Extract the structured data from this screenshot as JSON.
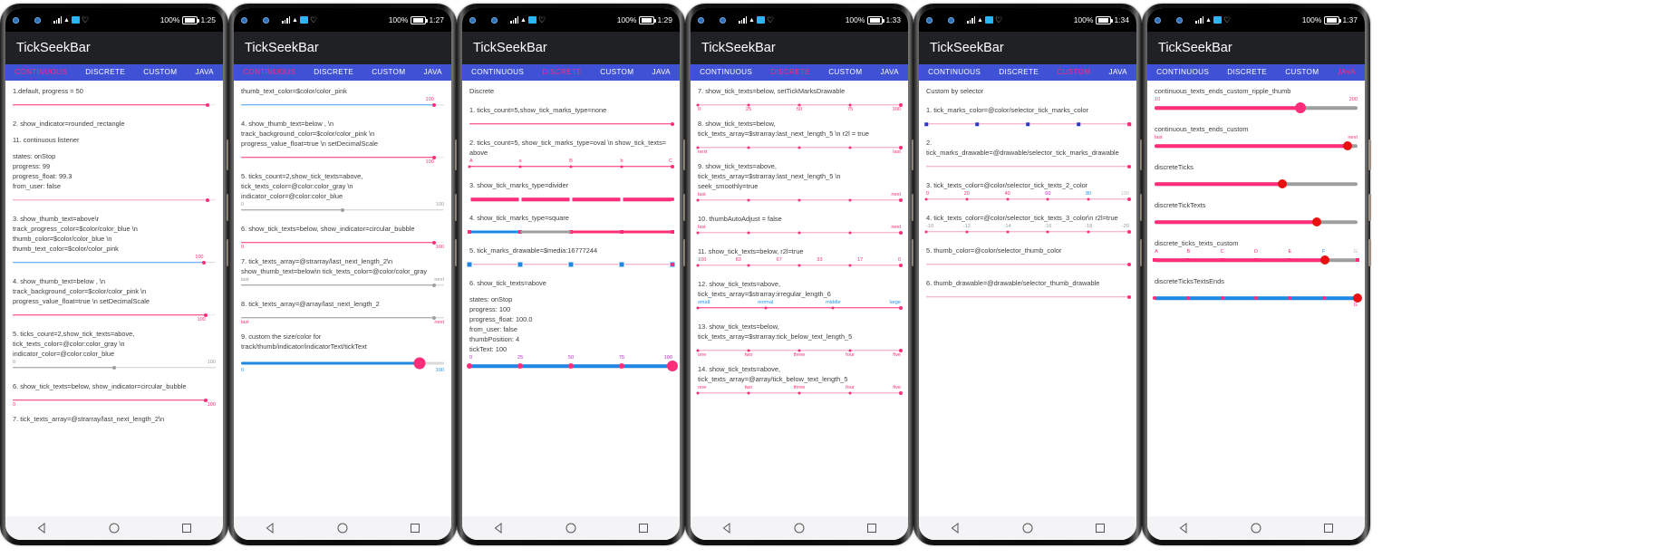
{
  "app": {
    "title": "TickSeekBar"
  },
  "tabs": [
    "CONTINUOUS",
    "DISCRETE",
    "CUSTOM",
    "JAVA"
  ],
  "status": {
    "battery_pct": "100%",
    "times": [
      "1:25",
      "1:27",
      "1:29",
      "1:33",
      "1:34",
      "1:37"
    ]
  },
  "phones": [
    {
      "active_tab": "CONTINUOUS",
      "time": "1:25",
      "blocks": [
        {
          "label": "1.default, progress = 50",
          "thumb_pct": 96,
          "prog_pct": 96,
          "track": "pink"
        },
        {
          "label": "2. show_indicator=rounded_rectangle"
        },
        {
          "label": "11. continuous listener"
        },
        {
          "label": "states: onStop\nprogress: 99\nprogress_float: 99.3\nfrom_user: false",
          "thumb_pct": 96,
          "prog_pct": 96,
          "track": "lightpink"
        },
        {
          "label": "3. show_thumb_text=above\\r track_progress_color=$color/color_blue          \\n thumb_color=$color/color_blue \\n thumb_text_color=$color/color_pink",
          "thumb_pct": 94,
          "prog_pct": 94,
          "track": "blue",
          "thumb_text": "100",
          "thumb_text_pos": "above"
        },
        {
          "label": "4. show_thumb_text=below , \\n track_background_color=$color/color_pink \\n progress_value_float=true \\n setDecimalScale",
          "thumb_pct": 95,
          "prog_pct": 95,
          "track": "pink",
          "thumb_text": "100",
          "thumb_text_pos": "below"
        },
        {
          "label": "5. ticks_count=2,show_tick_texts=above, tick_texts_color=@color:color_gray               \\n indicator_color=@color:color_blue",
          "thumb_pct": 50,
          "prog_pct": 50,
          "track": "gray",
          "tick_texts": [
            "0",
            "100"
          ],
          "tick_text_pos": "above",
          "tick_text_color": "gray"
        },
        {
          "label": "6. show_tick_texts=below, show_indicator=circular_bubble",
          "thumb_pct": 95,
          "prog_pct": 95,
          "track": "pink",
          "tick_texts": [
            "0",
            "100"
          ],
          "tick_text_pos": "below"
        },
        {
          "label": "7. tick_texts_array=@strarray/last_next_length_2\\n"
        }
      ]
    },
    {
      "active_tab": "CONTINUOUS",
      "time": "1:27",
      "blocks": [
        {
          "label": "thumb_text_color=$color/color_pink",
          "thumb_pct": 95,
          "prog_pct": 95,
          "track": "blue",
          "thumb_text": "100",
          "thumb_text_pos": "above"
        },
        {
          "label": "4. show_thumb_text=below , \\n track_background_color=$color/color_pink \\n progress_value_float=true \\n setDecimalScale",
          "thumb_pct": 95,
          "prog_pct": 95,
          "track": "pink",
          "thumb_text": "100",
          "thumb_text_pos": "below"
        },
        {
          "label": "5. ticks_count=2,show_tick_texts=above, tick_texts_color=@color:color_gray          \\n indicator_color=@color:color_blue",
          "thumb_pct": 50,
          "prog_pct": 50,
          "track": "gray",
          "tick_texts": [
            "0",
            "100"
          ],
          "tick_text_pos": "above",
          "tick_text_color": "gray"
        },
        {
          "label": "6. show_tick_texts=below, show_indicator=circular_bubble",
          "thumb_pct": 95,
          "prog_pct": 95,
          "track": "pink",
          "tick_texts": [
            "0",
            "100"
          ],
          "tick_text_pos": "below"
        },
        {
          "label": "7. tick_texts_array=@strarray/last_next_length_2\\n show_thumb_text=below\\n tick_texts_color=@color/color_gray",
          "thumb_pct": 95,
          "prog_pct": 95,
          "track": "gray",
          "tick_texts": [
            "last",
            "next"
          ],
          "tick_text_pos": "above",
          "tick_text_color": "gray"
        },
        {
          "label": "8. tick_texts_array=@array/last_next_length_2",
          "thumb_pct": 95,
          "prog_pct": 95,
          "track": "gray",
          "tick_texts": [
            "last",
            "next"
          ],
          "tick_text_pos": "below"
        },
        {
          "label": "9. custom the size/color for track/thumb/indicator/indicatorText/tickText",
          "thumb_pct": 88,
          "prog_pct": 88,
          "track": "blue-thick",
          "thumb_style": "green",
          "tick_texts": [
            "0",
            "100"
          ],
          "tick_text_pos": "below",
          "tick_text_color": "blue"
        }
      ]
    },
    {
      "active_tab": "DISCRETE",
      "time": "1:29",
      "heading": "Discrete",
      "blocks": [
        {
          "label": "1. ticks_count=5,show_tick_marks_type=none",
          "thumb_pct": 100,
          "prog_pct": 100,
          "track": "pink"
        },
        {
          "label": "2. ticks_count=5, show_tick_marks_type=oval \\n show_tick_texts= above",
          "thumb_pct": 100,
          "prog_pct": 100,
          "track": "pink",
          "ticks": 5,
          "tick_texts": [
            "A",
            "a",
            "B",
            "b",
            "C"
          ],
          "tick_text_pos": "above",
          "tick_text_color": "pink"
        },
        {
          "label": "3. show_tick_marks_type=divider",
          "thumb_pct": 100,
          "prog_pct": 100,
          "track": "pink-thicker",
          "ticks": 5,
          "tick_style": "divider"
        },
        {
          "label": "4. show_tick_marks_type=square",
          "thumb_pct": 100,
          "prog_pct": 100,
          "track": "mixed",
          "ticks": 5,
          "tick_style": "square"
        },
        {
          "label": "5. tick_marks_drawable=$media:16777244",
          "thumb_pct": 100,
          "prog_pct": 100,
          "track": "lightpink",
          "ticks": 5,
          "tick_style": "drawable"
        },
        {
          "label": "6. show_tick_texts=above"
        },
        {
          "label": "states: onStop\nprogress: 100\nprogress_float: 100.0\nfrom_user: false\nthumbPosition: 4\ntickText: 100",
          "thumb_pct": 100,
          "prog_pct": 100,
          "track": "blue-thicker",
          "ticks": 5,
          "tick_style": "bigdot",
          "tick_texts": [
            "0",
            "25",
            "50",
            "75",
            "100"
          ],
          "tick_text_pos": "above",
          "tick_text_color": "purple",
          "thumb_style": "big"
        }
      ]
    },
    {
      "active_tab": "DISCRETE",
      "time": "1:33",
      "blocks": [
        {
          "label": "7. show_tick_texts=below, setTickMarksDrawable",
          "thumb_pct": 100,
          "prog_pct": 100,
          "track": "lightpink",
          "ticks": 5,
          "tick_texts": [
            "0",
            "25",
            "50",
            "75",
            "100"
          ],
          "tick_text_pos": "below"
        },
        {
          "label": "8. show_tick_texts=below, tick_texts_array=$strarray:last_next_length_5 \\n r2l = true",
          "thumb_pct": 100,
          "prog_pct": 100,
          "track": "lightpink",
          "ticks": 5,
          "tick_texts": [
            "next",
            "",
            "",
            "",
            "last"
          ],
          "tick_text_pos": "below"
        },
        {
          "label": "9. show_tick_texts=above, tick_texts_array=$strarray:last_next_length_5 \\n seek_smoothly=true",
          "thumb_pct": 100,
          "prog_pct": 100,
          "track": "lightpink",
          "ticks": 5,
          "tick_texts": [
            "last",
            "",
            "",
            "",
            "next"
          ],
          "tick_text_pos": "above"
        },
        {
          "label": "10. thumbAutoAdjust = false",
          "thumb_pct": 100,
          "prog_pct": 100,
          "track": "lightpink",
          "ticks": 5,
          "tick_texts": [
            "last",
            "",
            "",
            "",
            "next"
          ],
          "tick_text_pos": "above"
        },
        {
          "label": "11. show_tick_texts=below, r2l=true",
          "thumb_pct": 100,
          "prog_pct": 100,
          "track": "lightpink",
          "ticks": 5,
          "tick_texts": [
            "100",
            "83",
            "67",
            "33",
            "17",
            "0"
          ],
          "tick_text_pos": "above"
        },
        {
          "label": "12. show_tick_texts=above, tick_texts_array=$strarray:irregular_length_6",
          "thumb_pct": 100,
          "prog_pct": 100,
          "track": "pink",
          "ticks": 4,
          "tick_texts": [
            "small",
            "normal",
            "middle",
            "large"
          ],
          "tick_text_pos": "above",
          "tick_text_color": "blue"
        },
        {
          "label": "13. show_tick_texts=below, tick_texts_array=$strarray:tick_below_text_length_5",
          "thumb_pct": 100,
          "prog_pct": 100,
          "track": "lightpink",
          "ticks": 5,
          "tick_texts": [
            "one",
            "two",
            "three",
            "four",
            "five"
          ],
          "tick_text_pos": "below"
        },
        {
          "label": "14. show_tick_texts=above, tick_texts_array=@array/tick_below_text_length_5",
          "thumb_pct": 100,
          "prog_pct": 100,
          "track": "lightpink",
          "ticks": 5,
          "tick_texts": [
            "one",
            "two",
            "three",
            "four",
            "five"
          ],
          "tick_text_pos": "above"
        }
      ]
    },
    {
      "active_tab": "CUSTOM",
      "time": "1:34",
      "heading": "Custom by selector",
      "blocks": [
        {
          "label": "1. tick_marks_color=@color/selector_tick_marks_color",
          "thumb_pct": 100,
          "prog_pct": 100,
          "track": "lightpink",
          "ticks": 5,
          "tick_style": "bluesq"
        },
        {
          "label": "2.\ntick_marks_drawable=@drawable/selector_tick_marks_drawable",
          "thumb_pct": 100,
          "prog_pct": 100,
          "track": "lightpink"
        },
        {
          "label": "3. tick_texts_color=@color/selector_tick_texts_2_color",
          "thumb_pct": 100,
          "prog_pct": 100,
          "track": "lightpink",
          "ticks": 6,
          "tick_texts": [
            "0",
            "20",
            "40",
            "60",
            "80",
            "100"
          ],
          "tick_text_pos": "above",
          "tick_text_color": "mixed"
        },
        {
          "label": "4. tick_texts_color=@color/selector_tick_texts_3_color\\n r2l=true",
          "thumb_pct": 100,
          "prog_pct": 100,
          "track": "lightpink",
          "ticks": 6,
          "tick_texts": [
            "-10",
            "-12",
            "-14",
            "-16",
            "-18",
            "-20"
          ],
          "tick_text_pos": "above",
          "tick_text_color": "gray"
        },
        {
          "label": "5. thumb_color=@color/selector_thumb_color",
          "thumb_pct": 100,
          "prog_pct": 100,
          "track": "lightpink"
        },
        {
          "label": "6. thumb_drawable=@drawable/selector_thumb_drawable",
          "thumb_pct": 100,
          "prog_pct": 100,
          "track": "lightpink"
        }
      ]
    },
    {
      "active_tab": "JAVA",
      "time": "1:37",
      "blocks": [
        {
          "label": "continuous_texts_ends_custom_ripple_thumb",
          "thumb_pct": 72,
          "prog_pct": 72,
          "track": "pink-thicker",
          "thumb_style": "big",
          "tick_texts": [
            "10",
            "200"
          ],
          "tick_text_pos": "above"
        },
        {
          "label": "continuous_texts_ends_custom",
          "thumb_pct": 95,
          "prog_pct": 95,
          "track": "pink-thicker",
          "thumb_style": "bigred",
          "tick_texts": [
            "last",
            "next"
          ],
          "tick_text_pos": "above"
        },
        {
          "label": "discreteTicks",
          "thumb_pct": 63,
          "prog_pct": 63,
          "track": "gray-thicker",
          "thumb_style": "bigred"
        },
        {
          "label": "discreteTickTexts",
          "thumb_pct": 80,
          "prog_pct": 80,
          "track": "gray-thicker",
          "thumb_style": "bigred"
        },
        {
          "label": "discrete_ticks_texts_custom",
          "thumb_pct": 84,
          "prog_pct": 84,
          "track": "pink-thicker",
          "ticks": 7,
          "tick_style": "square",
          "tick_texts": [
            "A",
            "B",
            "C",
            "D",
            "E",
            "F",
            "G"
          ],
          "tick_text_pos": "above",
          "tick_text_color": "mixed2",
          "thumb_style": "bigred"
        },
        {
          "label": "discreteTicksTextsEnds",
          "thumb_pct": 100,
          "prog_pct": 100,
          "track": "blue-thicker",
          "ticks": 7,
          "tick_style": "dot",
          "tick_texts": [
            "",
            "",
            "",
            "",
            "",
            "",
            "G"
          ],
          "tick_text_pos": "below",
          "thumb_style": "bigred"
        }
      ]
    }
  ],
  "nav": {
    "back": "back-triangle",
    "home": "home-circle",
    "recents": "recents-square"
  },
  "colors": {
    "accent_pink": "#ff2d7a",
    "tab_bar": "#3f51d5",
    "appbar": "#202124",
    "blue": "#2196f3",
    "green": "#17c217",
    "purple": "#c026d3",
    "red": "#e81010"
  }
}
